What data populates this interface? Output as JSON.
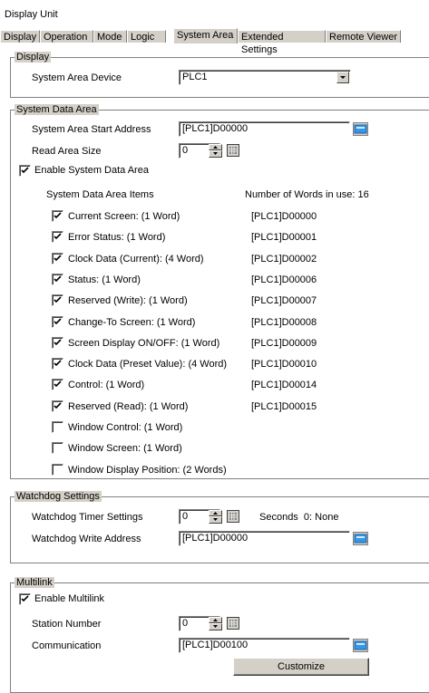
{
  "window": {
    "title": "Display Unit"
  },
  "tabs": [
    {
      "label": "Display"
    },
    {
      "label": "Operation"
    },
    {
      "label": "Mode"
    },
    {
      "label": "Logic"
    },
    {
      "label": "System Area"
    },
    {
      "label": "Extended Settings"
    },
    {
      "label": "Remote Viewer"
    }
  ],
  "display": {
    "group_label": "Display",
    "device_label": "System Area Device",
    "device_value": "PLC1"
  },
  "system_data": {
    "group_label": "System Data Area",
    "start_address_label": "System Area Start Address",
    "start_address_value": "[PLC1]D00000",
    "read_size_label": "Read Area Size",
    "read_size_value": "0",
    "enable_label": "Enable System Data Area",
    "enable_checked": true,
    "items_header": "System Data Area Items",
    "words_header": "Number of Words in use: 16",
    "items": [
      {
        "label": "Current Screen: (1 Word)",
        "address": "[PLC1]D00000",
        "checked": true
      },
      {
        "label": "Error Status: (1 Word)",
        "address": "[PLC1]D00001",
        "checked": true
      },
      {
        "label": "Clock Data (Current): (4 Word)",
        "address": "[PLC1]D00002",
        "checked": true
      },
      {
        "label": "Status: (1 Word)",
        "address": "[PLC1]D00006",
        "checked": true
      },
      {
        "label": "Reserved (Write): (1 Word)",
        "address": "[PLC1]D00007",
        "checked": true
      },
      {
        "label": "Change-To Screen: (1 Word)",
        "address": "[PLC1]D00008",
        "checked": true
      },
      {
        "label": "Screen Display ON/OFF: (1 Word)",
        "address": "[PLC1]D00009",
        "checked": true
      },
      {
        "label": "Clock Data (Preset Value): (4 Word)",
        "address": "[PLC1]D00010",
        "checked": true
      },
      {
        "label": "Control: (1 Word)",
        "address": "[PLC1]D00014",
        "checked": true
      },
      {
        "label": "Reserved (Read): (1 Word)",
        "address": "[PLC1]D00015",
        "checked": true
      },
      {
        "label": "Window Control: (1 Word)",
        "address": "",
        "checked": false
      },
      {
        "label": "Window Screen: (1 Word)",
        "address": "",
        "checked": false
      },
      {
        "label": "Window Display Position: (2 Words)",
        "address": "",
        "checked": false
      }
    ]
  },
  "watchdog": {
    "group_label": "Watchdog Settings",
    "timer_label": "Watchdog Timer Settings",
    "timer_value": "0",
    "timer_suffix": "Seconds  0: None",
    "write_address_label": "Watchdog Write Address",
    "write_address_value": "[PLC1]D00000"
  },
  "multilink": {
    "group_label": "Multilink",
    "enable_label": "Enable Multilink",
    "enable_checked": true,
    "station_label": "Station Number",
    "station_value": "0",
    "communication_label": "Communication",
    "communication_value": "[PLC1]D00100",
    "customize_label": "Customize"
  },
  "colors": {
    "face": "#d4d0c8",
    "shadow": "#808080",
    "address_icon": "#3399e6"
  }
}
